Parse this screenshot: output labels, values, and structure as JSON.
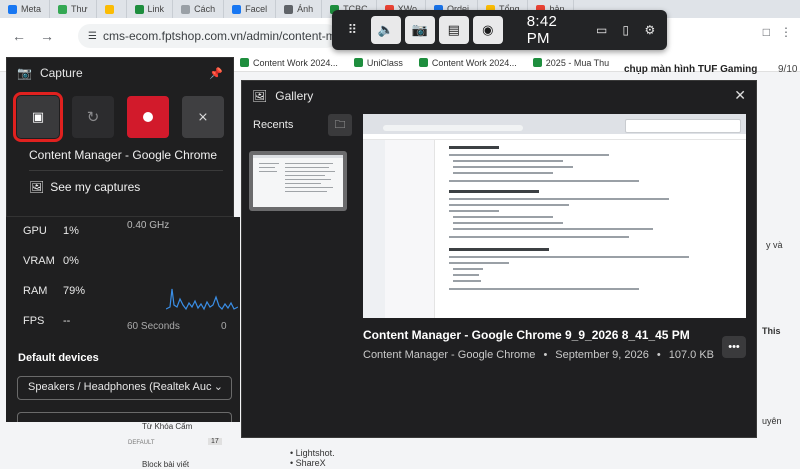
{
  "browser": {
    "tabs": [
      {
        "label": "Meta",
        "color": "#1877f2"
      },
      {
        "label": "Thư",
        "color": "#34a853"
      },
      {
        "label": "",
        "color": "#fbbc04"
      },
      {
        "label": "Link",
        "color": "#1e8e3e"
      },
      {
        "label": "Cách",
        "color": "#9aa0a6"
      },
      {
        "label": "Facel",
        "color": "#1877f2"
      },
      {
        "label": "Ánh",
        "color": "#5f6368"
      },
      {
        "label": "TCBC",
        "color": "#1e8e3e"
      },
      {
        "label": "XWo",
        "color": "#ea4335"
      },
      {
        "label": "Ordei",
        "color": "#1a73e8"
      },
      {
        "label": "Tổng",
        "color": "#fbbc04"
      },
      {
        "label": "bản",
        "color": "#ea4335"
      }
    ],
    "url": "cms-ecom.fptshop.com.vn/admin/content-mana",
    "bookmarks": [
      "Content Work 2024...",
      "UniClass",
      "Content Work 2024...",
      "2025 - Mua Thu"
    ],
    "right_title": "chụp màn hình TUF Gaming",
    "right_num": "9/10",
    "page_snips": {
      "a": "y và",
      "b": "This",
      "c": "uyên"
    },
    "left_items": {
      "item1": "Từ Khóa Cấm",
      "default": "DEFAULT",
      "count": "17",
      "item2": "Block bài viết"
    },
    "content_bullets": {
      "b1": "Lightshot.",
      "b2": "ShareX"
    }
  },
  "gamebar": {
    "time": "8:42 PM",
    "icons": [
      "widgets-icon",
      "audio-icon",
      "capture-icon",
      "performance-icon",
      "xbox-social-icon",
      "battery-icon",
      "mouse-icon",
      "settings-icon"
    ]
  },
  "capture": {
    "title": "Capture",
    "target": "Content Manager - Google Chrome",
    "see_captures": "See my captures"
  },
  "performance": {
    "ghz": "0.40 GHz",
    "rows": [
      {
        "label": "GPU",
        "value": "1%"
      },
      {
        "label": "VRAM",
        "value": "0%"
      },
      {
        "label": "RAM",
        "value": "79%"
      },
      {
        "label": "FPS",
        "value": "--"
      }
    ],
    "seconds": "60 Seconds",
    "zero": "0"
  },
  "devices": {
    "title": "Default devices",
    "speaker": "Speakers / Headphones (Realtek Auc"
  },
  "gallery": {
    "title": "Gallery",
    "recents": "Recents",
    "file_title": "Content Manager - Google Chrome 9_9_2026 8_41_45 PM",
    "app": "Content Manager - Google Chrome",
    "date": "September 9, 2026",
    "size": "107.0 KB",
    "dot": "•"
  }
}
